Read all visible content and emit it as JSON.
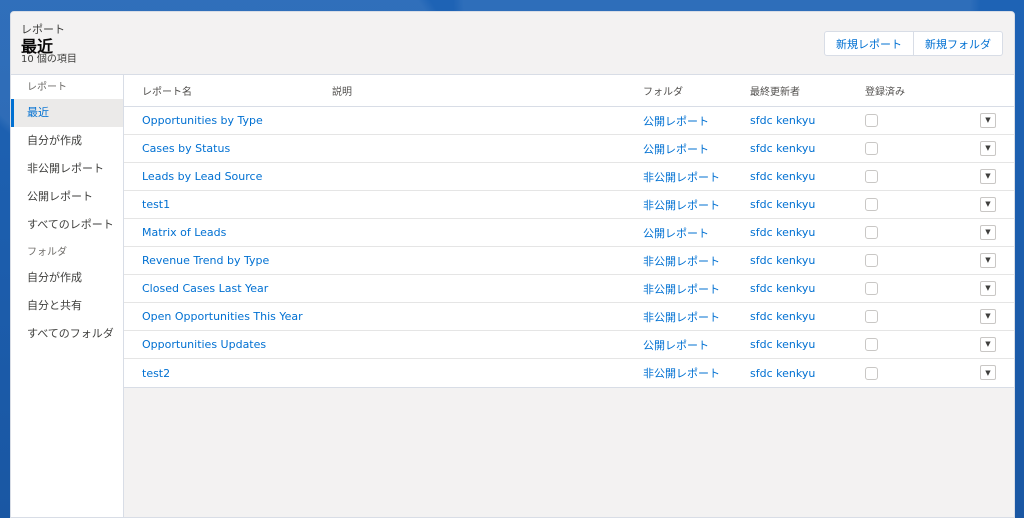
{
  "header": {
    "eyebrow": "レポート",
    "title": "最近",
    "count": "10 個の項目",
    "new_report_label": "新規レポート",
    "new_folder_label": "新規フォルダ"
  },
  "sidebar": {
    "reports_section": "レポート",
    "report_items": [
      "最近",
      "自分が作成",
      "非公開レポート",
      "公開レポート",
      "すべてのレポート"
    ],
    "folders_section": "フォルダ",
    "folder_items": [
      "自分が作成",
      "自分と共有",
      "すべてのフォルダ"
    ]
  },
  "table": {
    "columns": [
      "レポート名",
      "説明",
      "フォルダ",
      "最終更新者",
      "登録済み"
    ],
    "rows": [
      {
        "name": "Opportunities by Type",
        "description": "",
        "folder": "公開レポート",
        "owner": "sfdc kenkyu"
      },
      {
        "name": "Cases by Status",
        "description": "",
        "folder": "公開レポート",
        "owner": "sfdc kenkyu"
      },
      {
        "name": "Leads by Lead Source",
        "description": "",
        "folder": "非公開レポート",
        "owner": "sfdc kenkyu"
      },
      {
        "name": "test1",
        "description": "",
        "folder": "非公開レポート",
        "owner": "sfdc kenkyu"
      },
      {
        "name": "Matrix of Leads",
        "description": "",
        "folder": "公開レポート",
        "owner": "sfdc kenkyu"
      },
      {
        "name": "Revenue Trend by Type",
        "description": "",
        "folder": "非公開レポート",
        "owner": "sfdc kenkyu"
      },
      {
        "name": "Closed Cases Last Year",
        "description": "",
        "folder": "非公開レポート",
        "owner": "sfdc kenkyu"
      },
      {
        "name": "Open Opportunities This Year",
        "description": "",
        "folder": "非公開レポート",
        "owner": "sfdc kenkyu"
      },
      {
        "name": "Opportunities Updates",
        "description": "",
        "folder": "公開レポート",
        "owner": "sfdc kenkyu"
      },
      {
        "name": "test2",
        "description": "",
        "folder": "非公開レポート",
        "owner": "sfdc kenkyu"
      }
    ]
  },
  "colors": {
    "link": "#0070d2",
    "brand_bg": "#1b5aa8"
  }
}
